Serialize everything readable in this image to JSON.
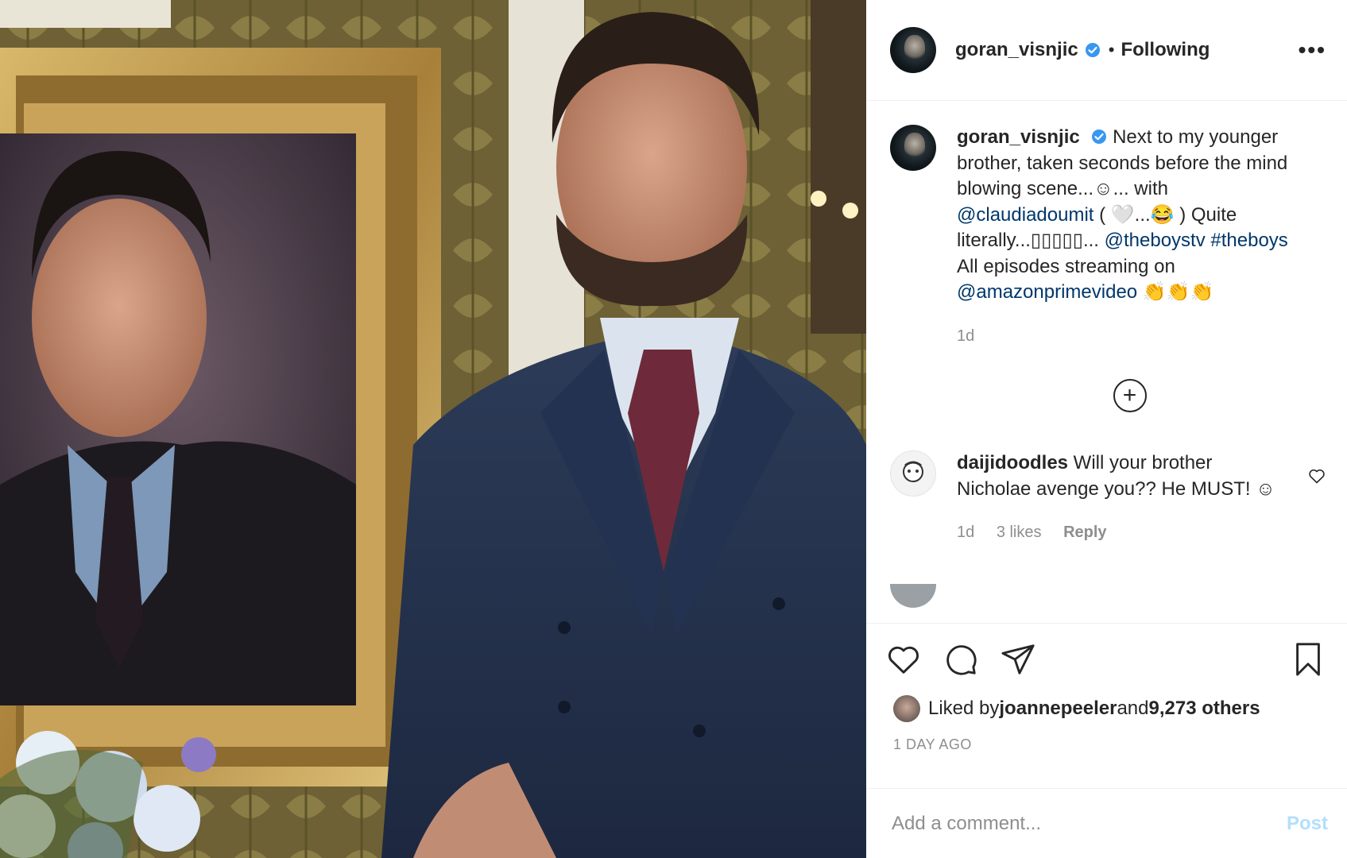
{
  "header": {
    "username": "goran_visnjic",
    "separator": "•",
    "follow_status": "Following",
    "more_label": "•••"
  },
  "caption": {
    "username": "goran_visnjic",
    "text_1": " Next to my younger brother, taken seconds before the mind blowing scene...☺... with ",
    "mention_1": "@claudiadoumit",
    "text_2": " ( 🤍...😂 ) Quite literally...▯▯▯▯▯... ",
    "mention_2": "@theboystv",
    "hashtag": "#theboys",
    "text_3": " All episodes streaming on ",
    "mention_3": "@amazonprimevideo",
    "text_4": " 👏👏👏",
    "time": "1d"
  },
  "load_more_label": "+",
  "comments": [
    {
      "username": "daijidoodles",
      "text": " Will your brother Nicholae avenge you?? He MUST! ☺",
      "time": "1d",
      "likes": "3 likes",
      "reply": "Reply"
    }
  ],
  "likes": {
    "prefix": "Liked by ",
    "user": "joannepeeler",
    "middle": " and ",
    "others": "9,273 others"
  },
  "timestamp": "1 DAY AGO",
  "add_comment": {
    "placeholder": "Add a comment...",
    "post_label": "Post"
  },
  "colors": {
    "link": "#00376b",
    "verified": "#3897f0",
    "muted": "#8e8e8e",
    "post_disabled": "#b2dffc"
  },
  "icons": {
    "like": "heart-icon",
    "comment": "comment-icon",
    "share": "share-icon",
    "save": "bookmark-icon",
    "more": "more-options-icon",
    "load_more": "plus-circle-icon"
  }
}
